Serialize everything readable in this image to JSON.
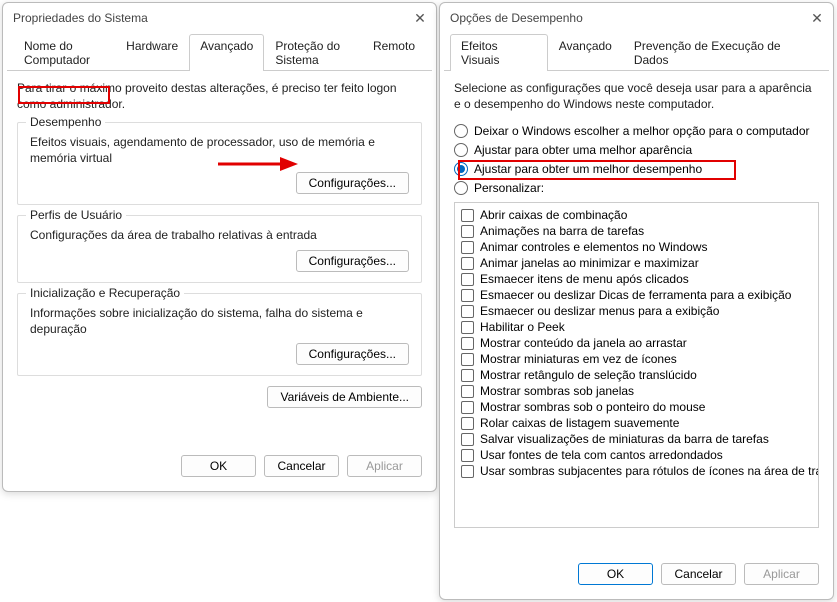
{
  "left": {
    "title": "Propriedades do Sistema",
    "tabs": [
      "Nome do Computador",
      "Hardware",
      "Avançado",
      "Proteção do Sistema",
      "Remoto"
    ],
    "active_tab": 2,
    "instr": "Para tirar o máximo proveito destas alterações, é preciso ter feito logon como administrador.",
    "groups": [
      {
        "title": "Desempenho",
        "desc": "Efeitos visuais, agendamento de processador, uso de memória e memória virtual",
        "button": "Configurações..."
      },
      {
        "title": "Perfis de Usuário",
        "desc": "Configurações da área de trabalho relativas à entrada",
        "button": "Configurações..."
      },
      {
        "title": "Inicialização e Recuperação",
        "desc": "Informações sobre inicialização do sistema, falha do sistema e depuração",
        "button": "Configurações..."
      }
    ],
    "env_button": "Variáveis de Ambiente...",
    "footer": {
      "ok": "OK",
      "cancel": "Cancelar",
      "apply": "Aplicar"
    }
  },
  "right": {
    "title": "Opções de Desempenho",
    "tabs": [
      "Efeitos Visuais",
      "Avançado",
      "Prevenção de Execução de Dados"
    ],
    "active_tab": 0,
    "instr": "Selecione as configurações que você deseja usar para a aparência e o desempenho do Windows neste computador.",
    "radios": [
      "Deixar o Windows escolher a melhor opção para o computador",
      "Ajustar para obter uma melhor aparência",
      "Ajustar para obter um melhor desempenho",
      "Personalizar:"
    ],
    "selected_radio": 2,
    "checks": [
      "Abrir caixas de combinação",
      "Animações na barra de tarefas",
      "Animar controles e elementos no Windows",
      "Animar janelas ao minimizar e maximizar",
      "Esmaecer itens de menu após clicados",
      "Esmaecer ou deslizar Dicas de ferramenta para a exibição",
      "Esmaecer ou deslizar menus para a exibição",
      "Habilitar o Peek",
      "Mostrar conteúdo da janela ao arrastar",
      "Mostrar miniaturas em vez de ícones",
      "Mostrar retângulo de seleção translúcido",
      "Mostrar sombras sob janelas",
      "Mostrar sombras sob o ponteiro do mouse",
      "Rolar caixas de listagem suavemente",
      "Salvar visualizações de miniaturas da barra de tarefas",
      "Usar fontes de tela com cantos arredondados",
      "Usar sombras subjacentes para rótulos de ícones na área de trabalho"
    ],
    "footer": {
      "ok": "OK",
      "cancel": "Cancelar",
      "apply": "Aplicar"
    }
  }
}
